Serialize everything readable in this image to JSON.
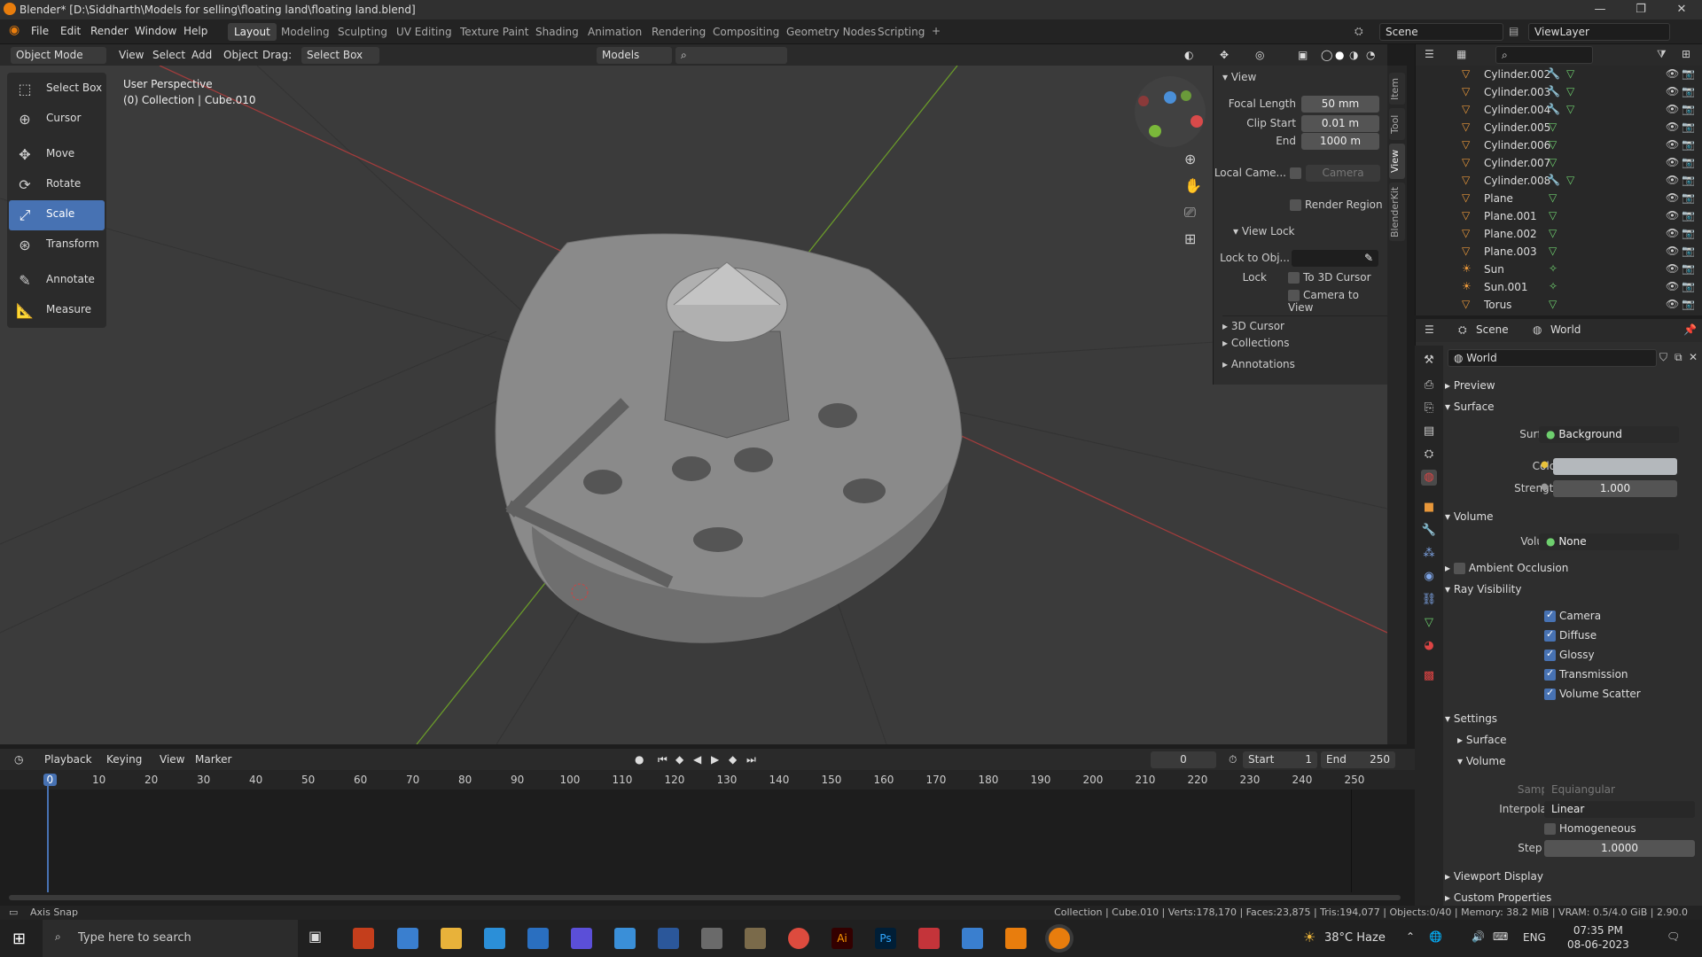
{
  "window": {
    "title": "Blender* [D:\\Siddharth\\Models for selling\\floating land\\floating land.blend]"
  },
  "menu": [
    "File",
    "Edit",
    "Render",
    "Window",
    "Help"
  ],
  "workspaces": [
    "Layout",
    "Modeling",
    "Sculpting",
    "UV Editing",
    "Texture Paint",
    "Shading",
    "Animation",
    "Rendering",
    "Compositing",
    "Geometry Nodes",
    "Scripting"
  ],
  "active_workspace": "Layout",
  "scene": {
    "name": "Scene",
    "view_layer": "ViewLayer"
  },
  "viewport_header": {
    "mode": "Object Mode",
    "menus": [
      "View",
      "Select",
      "Add",
      "Object"
    ],
    "drag_label": "Drag:",
    "drag_value": "Select Box",
    "orientation": "Models"
  },
  "tools": [
    "Select Box",
    "Cursor",
    "Move",
    "Rotate",
    "Scale",
    "Transform",
    "Annotate",
    "Measure"
  ],
  "active_tool": "Scale",
  "viewport_info": {
    "perspective": "User Perspective",
    "collection": "(0) Collection | Cube.010"
  },
  "npanel": {
    "tabs": [
      "Item",
      "Tool",
      "View",
      "BlenderKit"
    ],
    "active_tab": "View",
    "view_header": "View",
    "focal_length_label": "Focal Length",
    "focal_length": "50 mm",
    "clip_start_label": "Clip Start",
    "clip_start": "0.01 m",
    "clip_end_label": "End",
    "clip_end": "1000 m",
    "local_camera_label": "Local Came...",
    "camera_placeholder": "Camera",
    "render_region": "Render Region",
    "view_lock_header": "View Lock",
    "lock_to_obj_label": "Lock to Obj...",
    "lock_label": "Lock",
    "to_3d_cursor": "To 3D Cursor",
    "camera_to_view": "Camera to View",
    "sections": [
      "3D Cursor",
      "Collections",
      "Annotations"
    ]
  },
  "outliner": [
    {
      "name": "Cylinder.002",
      "type": "mesh",
      "modifier": true
    },
    {
      "name": "Cylinder.003",
      "type": "mesh",
      "modifier": true
    },
    {
      "name": "Cylinder.004",
      "type": "mesh",
      "modifier": true
    },
    {
      "name": "Cylinder.005",
      "type": "mesh",
      "modifier": false
    },
    {
      "name": "Cylinder.006",
      "type": "mesh",
      "modifier": false
    },
    {
      "name": "Cylinder.007",
      "type": "mesh",
      "modifier": false
    },
    {
      "name": "Cylinder.008",
      "type": "mesh",
      "modifier": true
    },
    {
      "name": "Plane",
      "type": "mesh",
      "modifier": false
    },
    {
      "name": "Plane.001",
      "type": "mesh",
      "modifier": false
    },
    {
      "name": "Plane.002",
      "type": "mesh",
      "modifier": false
    },
    {
      "name": "Plane.003",
      "type": "mesh",
      "modifier": false
    },
    {
      "name": "Sun",
      "type": "light",
      "modifier": false
    },
    {
      "name": "Sun.001",
      "type": "light",
      "modifier": false
    },
    {
      "name": "Torus",
      "type": "mesh",
      "modifier": false
    }
  ],
  "properties": {
    "breadcrumb_scene": "Scene",
    "breadcrumb_world": "World",
    "world_name": "World",
    "preview": "Preview",
    "surface_header": "Surface",
    "surface_label": "Surface",
    "surface_value": "Background",
    "color_label": "Color",
    "color_swatch": "#b4b8bc",
    "strength_label": "Strength",
    "strength_value": "1.000",
    "volume_header": "Volume",
    "volume_label": "Volume",
    "volume_value": "None",
    "ambient_occlusion": "Ambient Occlusion",
    "ray_visibility": "Ray Visibility",
    "rays": [
      "Camera",
      "Diffuse",
      "Glossy",
      "Transmission",
      "Volume Scatter"
    ],
    "settings": "Settings",
    "settings_surface": "Surface",
    "settings_volume": "Volume",
    "sampling_label": "Sampling",
    "sampling_value": "Equiangular",
    "interpolation_label": "Interpolation",
    "interpolation_value": "Linear",
    "homogeneous": "Homogeneous",
    "step_size_label": "Step Size",
    "step_size_value": "1.0000",
    "viewport_display": "Viewport Display",
    "custom_properties": "Custom Properties"
  },
  "timeline": {
    "menus": [
      "Playback",
      "Keying",
      "View",
      "Marker"
    ],
    "current_frame": "0",
    "start_label": "Start",
    "start": "1",
    "end_label": "End",
    "end": "250",
    "ticks": [
      "0",
      "10",
      "20",
      "30",
      "40",
      "50",
      "60",
      "70",
      "80",
      "90",
      "100",
      "110",
      "120",
      "130",
      "140",
      "150",
      "160",
      "170",
      "180",
      "190",
      "200",
      "210",
      "220",
      "230",
      "240",
      "250"
    ]
  },
  "status": {
    "left": "Axis Snap",
    "right": "Collection | Cube.010 | Verts:178,170 | Faces:23,875 | Tris:194,077 | Objects:0/40 | Memory: 38.2 MiB | VRAM: 0.5/4.0 GiB | 2.90.0"
  },
  "taskbar": {
    "search_placeholder": "Type here to search",
    "weather": "38°C  Haze",
    "language": "ENG",
    "time": "07:35 PM",
    "date": "08-06-2023"
  }
}
